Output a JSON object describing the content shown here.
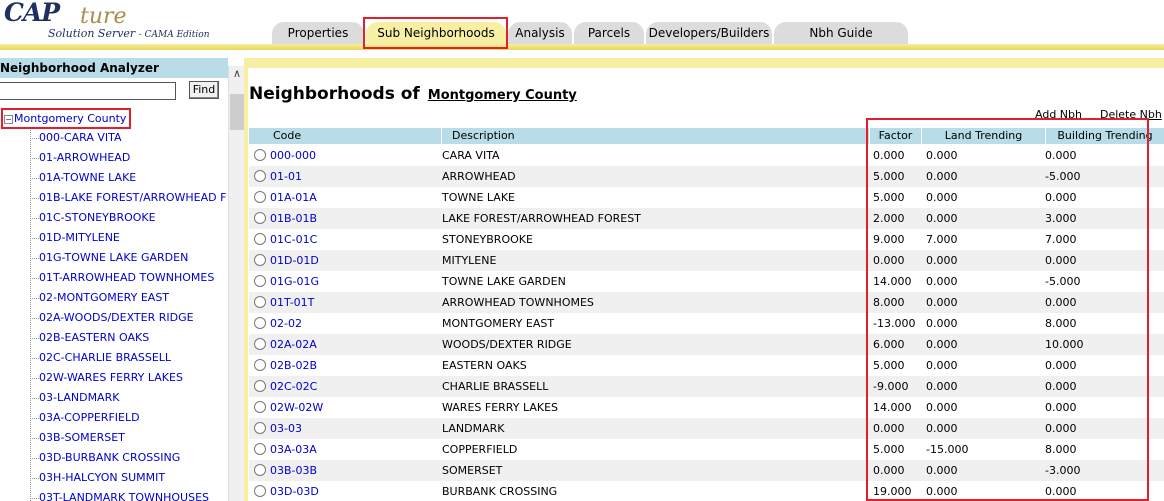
{
  "app": {
    "logo_main": "CAP",
    "logo_script": "ture",
    "logo_sub_main": "Solution Server",
    "logo_sub_edition": "- CAMA Edition"
  },
  "tabs": [
    {
      "label": "Properties",
      "active": false
    },
    {
      "label": "Sub Neighborhoods",
      "active": true
    },
    {
      "label": "Analysis",
      "active": false
    },
    {
      "label": "Parcels",
      "active": false
    },
    {
      "label": "Developers/Builders",
      "active": false
    },
    {
      "label": "Nbh Guide",
      "active": false
    }
  ],
  "sidebar": {
    "title": "Neighborhood Analyzer",
    "search_value": "",
    "find_label": "Find",
    "root": "Montgomery County",
    "items": [
      "000-CARA VITA",
      "01-ARROWHEAD",
      "01A-TOWNE LAKE",
      "01B-LAKE FOREST/ARROWHEAD F",
      "01C-STONEYBROOKE",
      "01D-MITYLENE",
      "01G-TOWNE LAKE GARDEN",
      "01T-ARROWHEAD TOWNHOMES",
      "02-MONTGOMERY EAST",
      "02A-WOODS/DEXTER RIDGE",
      "02B-EASTERN OAKS",
      "02C-CHARLIE BRASSELL",
      "02W-WARES FERRY LAKES",
      "03-LANDMARK",
      "03A-COPPERFIELD",
      "03B-SOMERSET",
      "03D-BURBANK CROSSING",
      "03H-HALCYON SUMMIT",
      "03T-LANDMARK TOWNHOUSES"
    ]
  },
  "main": {
    "title_prefix": "Neighborhoods of",
    "county": "Montgomery County",
    "add_link": "Add Nbh",
    "delete_link": "Delete Nbh",
    "columns": {
      "code": "Code",
      "description": "Description",
      "factor": "Factor",
      "land": "Land Trending",
      "building": "Building Trending"
    },
    "rows": [
      {
        "code": "000-000",
        "description": "CARA VITA",
        "factor": "0.000",
        "land": "0.000",
        "building": "0.000"
      },
      {
        "code": "01-01",
        "description": "ARROWHEAD",
        "factor": "5.000",
        "land": "0.000",
        "building": "-5.000"
      },
      {
        "code": "01A-01A",
        "description": "TOWNE LAKE",
        "factor": "5.000",
        "land": "0.000",
        "building": "0.000"
      },
      {
        "code": "01B-01B",
        "description": "LAKE FOREST/ARROWHEAD FOREST",
        "factor": "2.000",
        "land": "0.000",
        "building": "3.000"
      },
      {
        "code": "01C-01C",
        "description": "STONEYBROOKE",
        "factor": "9.000",
        "land": "7.000",
        "building": "7.000"
      },
      {
        "code": "01D-01D",
        "description": "MITYLENE",
        "factor": "0.000",
        "land": "0.000",
        "building": "0.000"
      },
      {
        "code": "01G-01G",
        "description": "TOWNE LAKE GARDEN",
        "factor": "14.000",
        "land": "0.000",
        "building": "-5.000"
      },
      {
        "code": "01T-01T",
        "description": "ARROWHEAD TOWNHOMES",
        "factor": "8.000",
        "land": "0.000",
        "building": "0.000"
      },
      {
        "code": "02-02",
        "description": "MONTGOMERY EAST",
        "factor": "-13.000",
        "land": "0.000",
        "building": "8.000"
      },
      {
        "code": "02A-02A",
        "description": "WOODS/DEXTER RIDGE",
        "factor": "6.000",
        "land": "0.000",
        "building": "10.000"
      },
      {
        "code": "02B-02B",
        "description": "EASTERN OAKS",
        "factor": "5.000",
        "land": "0.000",
        "building": "0.000"
      },
      {
        "code": "02C-02C",
        "description": "CHARLIE BRASSELL",
        "factor": "-9.000",
        "land": "0.000",
        "building": "0.000"
      },
      {
        "code": "02W-02W",
        "description": "WARES FERRY LAKES",
        "factor": "14.000",
        "land": "0.000",
        "building": "0.000"
      },
      {
        "code": "03-03",
        "description": "LANDMARK",
        "factor": "0.000",
        "land": "0.000",
        "building": "0.000"
      },
      {
        "code": "03A-03A",
        "description": "COPPERFIELD",
        "factor": "5.000",
        "land": "-15.000",
        "building": "8.000"
      },
      {
        "code": "03B-03B",
        "description": "SOMERSET",
        "factor": "0.000",
        "land": "0.000",
        "building": "-3.000"
      },
      {
        "code": "03D-03D",
        "description": "BURBANK CROSSING",
        "factor": "19.000",
        "land": "0.000",
        "building": "0.000"
      }
    ]
  },
  "colors": {
    "accent_gold": "#f7efa4",
    "header_blue": "#b8dce8",
    "link_blue": "#0000cc",
    "highlight_red": "#e0202a"
  }
}
